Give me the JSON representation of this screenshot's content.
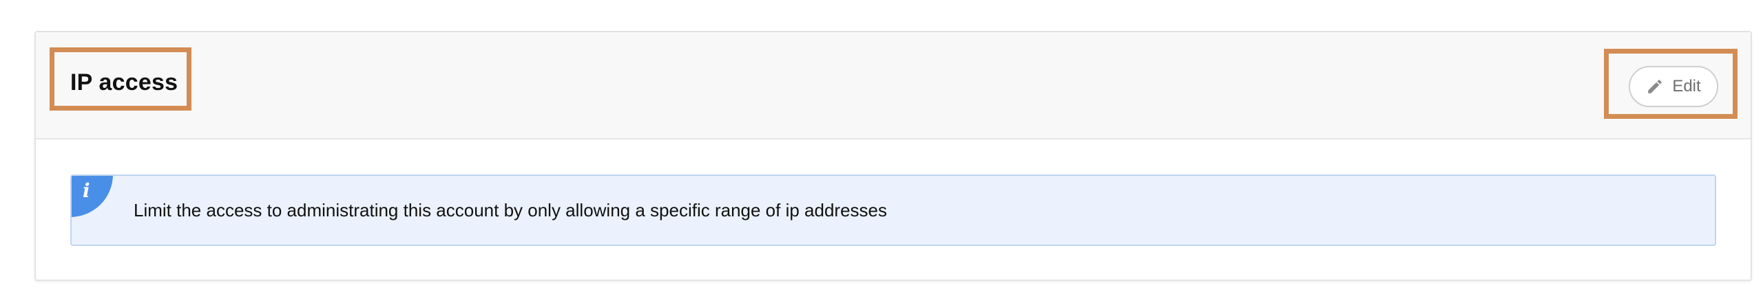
{
  "panel": {
    "title": "IP access",
    "edit_label": "Edit",
    "info_icon": "info-icon",
    "edit_icon": "pencil-icon",
    "info_message": "Limit the access to administrating this account by only allowing a specific range of ip addresses"
  },
  "colors": {
    "highlight": "#d38c54",
    "info_background": "#ebf2fd",
    "info_border": "#bfd4f2",
    "info_accent": "#4a8fe7",
    "header_background": "#f8f8f8"
  }
}
